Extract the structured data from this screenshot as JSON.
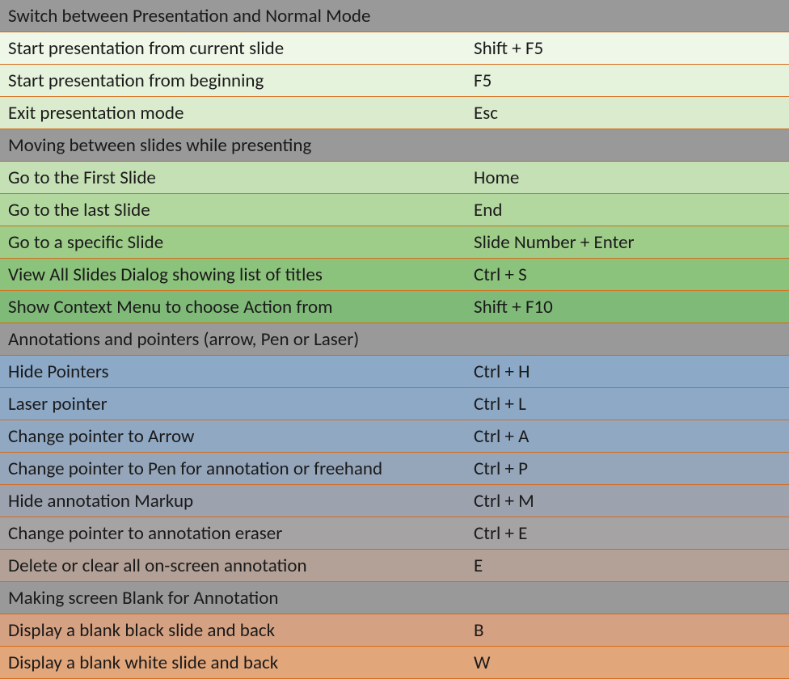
{
  "sections": [
    {
      "title": "Switch between Presentation and Normal Mode",
      "rows": [
        {
          "desc": "Start presentation from current slide",
          "key": "Shift + F5"
        },
        {
          "desc": "Start presentation from beginning",
          "key": "F5"
        },
        {
          "desc": "Exit presentation mode",
          "key": "Esc"
        }
      ]
    },
    {
      "title": "Moving between slides while presenting",
      "rows": [
        {
          "desc": "Go to the First Slide",
          "key": "Home"
        },
        {
          "desc": "Go to the last Slide",
          "key": "End"
        },
        {
          "desc": "Go to a specific Slide",
          "key": "Slide Number + Enter"
        },
        {
          "desc": "View All Slides Dialog showing list of titles",
          "key": "Ctrl + S"
        },
        {
          "desc": "Show Context Menu to choose Action from",
          "key": "Shift + F10"
        }
      ]
    },
    {
      "title": "Annotations and pointers (arrow, Pen or Laser)",
      "rows": [
        {
          "desc": "Hide Pointers",
          "key": "Ctrl + H"
        },
        {
          "desc": "Laser pointer",
          "key": "Ctrl + L"
        },
        {
          "desc": "Change pointer to Arrow",
          "key": "Ctrl + A"
        },
        {
          "desc": "Change pointer to Pen for annotation or freehand",
          "key": "Ctrl +  P"
        },
        {
          "desc": "Hide annotation Markup",
          "key": "Ctrl + M"
        },
        {
          "desc": "Change pointer to annotation eraser",
          "key": "Ctrl + E"
        },
        {
          "desc": "Delete or clear all on-screen annotation",
          "key": "E"
        }
      ]
    },
    {
      "title": "Making screen Blank for Annotation",
      "rows": [
        {
          "desc": "Display a blank black slide and back",
          "key": "B"
        },
        {
          "desc": "Display a blank white slide and back",
          "key": "W"
        }
      ]
    }
  ]
}
